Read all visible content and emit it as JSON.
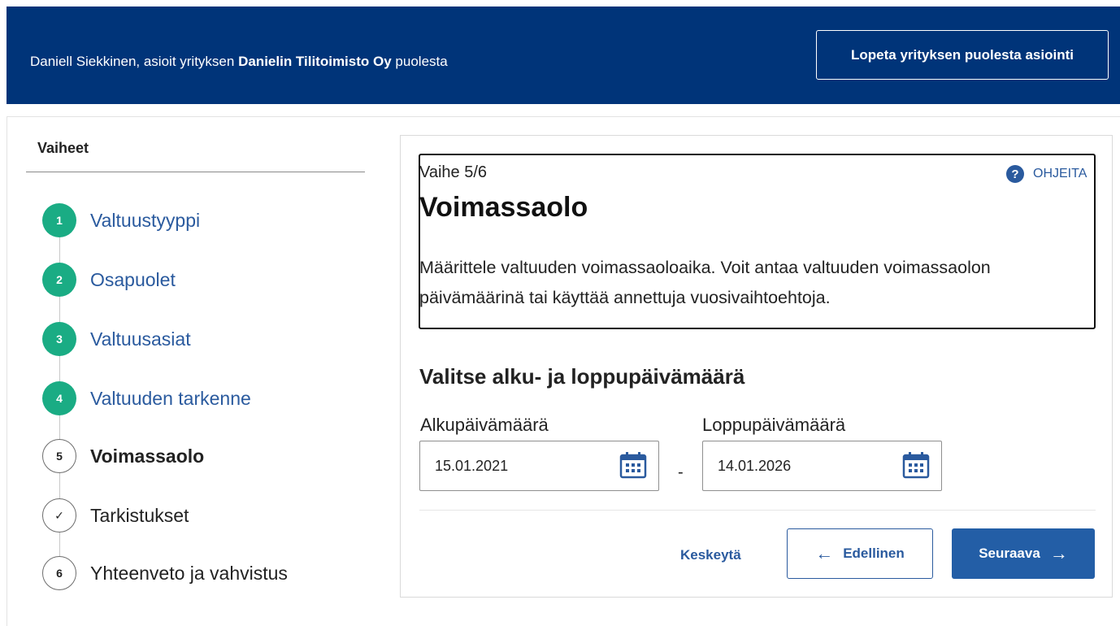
{
  "header": {
    "acting_user": "Daniell Siekkinen, asioit yrityksen",
    "company": "Danielin Tilitoimisto Oy",
    "acting_suffix": "puolesta",
    "end_button_label": "Lopeta yrityksen puolesta asiointi",
    "background_color": "#003479"
  },
  "sidebar": {
    "title": "Vaiheet",
    "steps": [
      {
        "marker": "1",
        "label": "Valtuustyyppi",
        "state": "done"
      },
      {
        "marker": "2",
        "label": "Osapuolet",
        "state": "done"
      },
      {
        "marker": "3",
        "label": "Valtuusasiat",
        "state": "done"
      },
      {
        "marker": "4",
        "label": "Valtuuden tarkenne",
        "state": "done"
      },
      {
        "marker": "5",
        "label": "Voimassaolo",
        "state": "current"
      },
      {
        "marker": "✓",
        "label": "Tarkistukset",
        "state": "todo"
      },
      {
        "marker": "6",
        "label": "Yhteenveto ja vahvistus",
        "state": "todo"
      }
    ],
    "done_color": "#1aac84"
  },
  "main": {
    "phase": "Vaihe 5/6",
    "help_label": "OHJEITA",
    "help_icon": "?",
    "title": "Voimassaolo",
    "description": "Määrittele valtuuden voimassaoloaika. Voit antaa valtuuden voimassaolon päivämäärinä tai käyttää annettuja vuosivaihtoehtoja.",
    "section_title": "Valitse alku- ja loppupäivämäärä",
    "start": {
      "label": "Alkupäivämäärä",
      "value": "15.01.2021",
      "icon": "calendar-icon"
    },
    "separator": "-",
    "end": {
      "label": "Loppupäivämäärä",
      "value": "14.01.2026",
      "icon": "calendar-icon"
    }
  },
  "actions": {
    "cancel_label": "Keskeytä",
    "prev_label": "Edellinen",
    "next_label": "Seuraava",
    "prev_arrow": "←",
    "next_arrow": "→",
    "accent_color": "#235ea6"
  }
}
